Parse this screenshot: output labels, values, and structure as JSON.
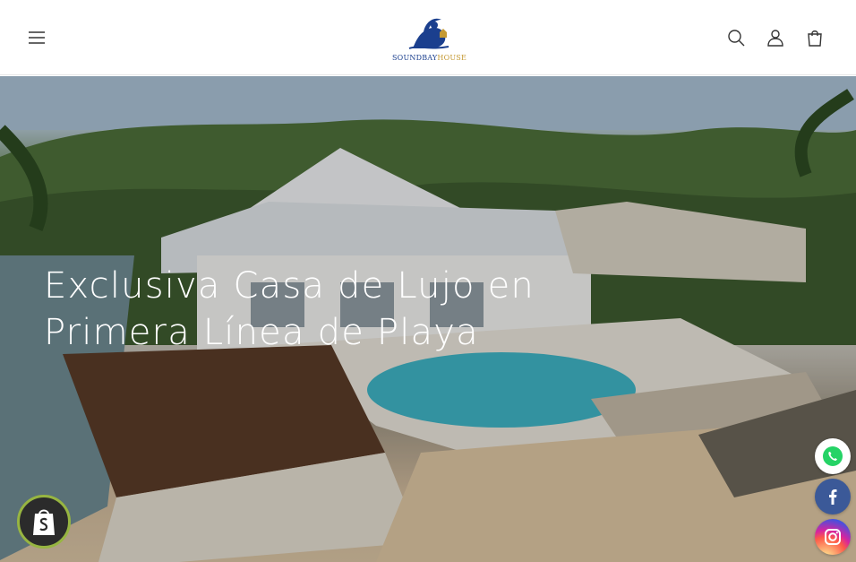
{
  "header": {
    "menu_icon": "hamburger-menu-icon",
    "logo": {
      "text_main": "SOUNDBAY",
      "text_accent": "HOUSE"
    },
    "search_icon": "search-icon",
    "account_icon": "user-account-icon",
    "cart_icon": "shopping-bag-icon"
  },
  "hero": {
    "title": "Exclusiva Casa de Lujo en Primera Línea de Playa"
  },
  "floating": {
    "shop_badge_icon": "shopify-bag-icon",
    "social": [
      {
        "name": "whatsapp",
        "icon": "whatsapp-icon",
        "color": "#25d366"
      },
      {
        "name": "facebook",
        "icon": "facebook-icon",
        "color": "#3b5998"
      },
      {
        "name": "instagram",
        "icon": "instagram-icon",
        "color": "#d6249f"
      }
    ]
  },
  "colors": {
    "logo_blue": "#1b3f8e",
    "logo_gold": "#c59a34",
    "shop_badge_ring": "#97b541"
  }
}
